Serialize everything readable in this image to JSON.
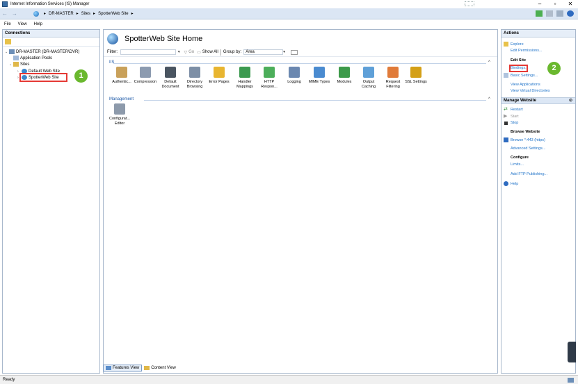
{
  "window": {
    "title": "Internet Information Services (IS) Manager"
  },
  "window_controls": {
    "minimize": "–",
    "maximize": "▫",
    "close": "✕"
  },
  "address": {
    "crumbs": [
      "DR-MASTER",
      "Sites",
      "SpotterWeb Site"
    ]
  },
  "menu": {
    "items": [
      "File",
      "View",
      "Help"
    ]
  },
  "connections": {
    "header": "Connections",
    "tree": {
      "server": "DR-MASTER (DR-MASTER\\DVR)",
      "app_pools": "Application Pools",
      "sites": "Sites",
      "default_site": "Default Web Site",
      "spotter_site": "SpotterWeb Site"
    }
  },
  "callouts": {
    "one": "1",
    "two": "2"
  },
  "content": {
    "title": "SpotterWeb Site Home",
    "filter": {
      "label": "Filter:",
      "go": "Go",
      "show_all": "Show All",
      "group_by_label": "Group by:",
      "group_by_value": "Area"
    },
    "groups": {
      "iis": "IIS",
      "management": "Management"
    },
    "iis_features": [
      {
        "line1": "Authentic...",
        "line2": "",
        "icon": "authentication-icon"
      },
      {
        "line1": "Compression",
        "line2": "",
        "icon": "compression-icon"
      },
      {
        "line1": "Default",
        "line2": "Document",
        "icon": "default-document-icon"
      },
      {
        "line1": "Directory",
        "line2": "Browsing",
        "icon": "directory-browsing-icon"
      },
      {
        "line1": "Error Pages",
        "line2": "",
        "icon": "error-pages-icon"
      },
      {
        "line1": "Handler",
        "line2": "Mappings",
        "icon": "handler-mappings-icon"
      },
      {
        "line1": "HTTP",
        "line2": "Respon...",
        "icon": "http-response-icon"
      },
      {
        "line1": "Logging",
        "line2": "",
        "icon": "logging-icon"
      },
      {
        "line1": "MIME Types",
        "line2": "",
        "icon": "mime-types-icon"
      },
      {
        "line1": "Modules",
        "line2": "",
        "icon": "modules-icon"
      },
      {
        "line1": "Output",
        "line2": "Caching",
        "icon": "output-caching-icon"
      },
      {
        "line1": "Request",
        "line2": "Filtering",
        "icon": "request-filtering-icon"
      },
      {
        "line1": "SSL Settings",
        "line2": "",
        "icon": "ssl-settings-icon"
      }
    ],
    "management_features": [
      {
        "line1": "Configurat...",
        "line2": "Editor",
        "icon": "configuration-editor-icon"
      }
    ]
  },
  "view_tabs": {
    "features": "Features View",
    "content": "Content View"
  },
  "actions": {
    "header": "Actions",
    "explore": "Explore",
    "edit_permissions": "Edit Permissions...",
    "edit_site_heading": "Edit Site",
    "bindings": "Bindings...",
    "basic_settings": "Basic Settings...",
    "view_applications": "View Applications",
    "view_virtual_dirs": "View Virtual Directories",
    "manage_website": "Manage Website",
    "restart": "Restart",
    "start": "Start",
    "stop": "Stop",
    "browse_heading": "Browse Website",
    "browse_443": "Browse *:443 (https)",
    "advanced_settings": "Advanced Settings...",
    "configure_heading": "Configure",
    "limits": "Limits...",
    "add_ftp": "Add FTP Publishing...",
    "help": "Help"
  },
  "status": {
    "text": "Ready"
  },
  "colors": {
    "link": "#1e72c8",
    "callout": "#6ab82e",
    "highlight": "#e53935",
    "pane_header": "#e6eef8"
  }
}
